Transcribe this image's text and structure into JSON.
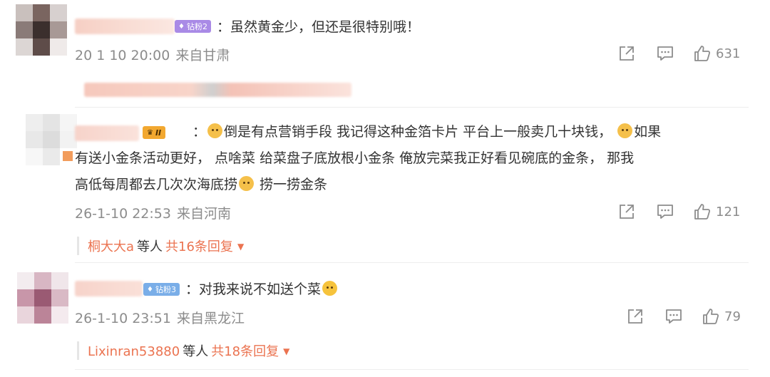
{
  "comments": [
    {
      "badge": "钻粉2",
      "text": "：虽然黄金少，但还是很特别哦！",
      "timestamp": "20 1 10 20:00",
      "location": "来自甘肃",
      "like_count": "631"
    },
    {
      "badge": "II",
      "text_line1_a": "：",
      "text_line1_b": "倒是有点营销手段 我记得这种金箔卡片 平台上一般卖几十块钱，",
      "text_line1_c": "如果",
      "text_line2": "有送小金条活动更好， 点啥菜 给菜盘子底放根小金条 俺放完菜我正好看见碗底的金条， 那我",
      "text_line3_a": "高低每周都去几次次海底捞",
      "text_line3_b": " 捞一捞金条",
      "timestamp": "26-1-10 22:53",
      "location": "来自河南",
      "like_count": "121",
      "reply_names": "桐大大a",
      "reply_mid": "等人",
      "reply_total": "共16条回复"
    },
    {
      "badge": "钻粉3",
      "text": "：对我来说不如送个菜",
      "timestamp": "26-1-10 23:51",
      "location": "来自黑龙江",
      "like_count": "79",
      "reply_names": "Lixinran53880",
      "reply_mid": "等人",
      "reply_total": "共18条回复"
    }
  ],
  "icons": {
    "share": "share-icon",
    "comment": "comment-icon",
    "like": "thumbs-up-icon",
    "caret": "caret-down-icon"
  },
  "colors": {
    "accent": "#eb7350",
    "meta_gray": "#8c8c8c",
    "badge_purple": "#a07de8",
    "badge_blue": "#6fa6e8"
  }
}
